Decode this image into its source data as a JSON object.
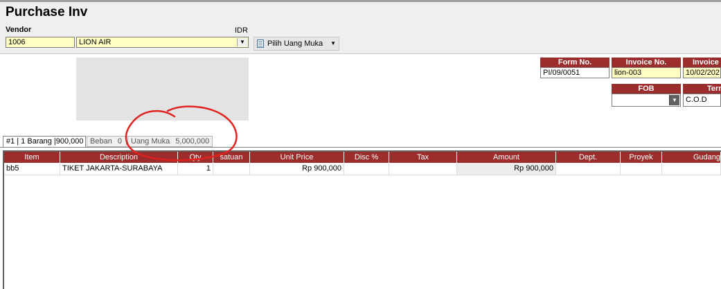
{
  "window": {
    "title": "Purchase Inv"
  },
  "vendor": {
    "label": "Vendor",
    "code": "1006",
    "name": "LION AIR",
    "currency": "IDR"
  },
  "toolbar": {
    "uang_muka_button": "Pilih Uang Muka"
  },
  "header_fields": {
    "form_no_label": "Form No.",
    "form_no_value": "PI/09/0051",
    "invoice_no_label": "Invoice No.",
    "invoice_no_value": "lion-003",
    "invoice_date_label": "Invoice",
    "invoice_date_value": "10/02/202",
    "fob_label": "FOB",
    "fob_value": "",
    "term_label": "Term",
    "term_value": "C.O.D"
  },
  "tabs": [
    {
      "label": "#1 | 1 Barang |900,000",
      "count": ""
    },
    {
      "label": "Beban",
      "count": "0"
    },
    {
      "label": "Uang Muka",
      "count": "5,000,000"
    }
  ],
  "grid": {
    "columns": [
      "Item",
      "Description",
      "Qty",
      "satuan",
      "Unit Price",
      "Disc %",
      "Tax",
      "Amount",
      "Dept.",
      "Proyek",
      "Gudang"
    ],
    "rows": [
      {
        "item": "bb5",
        "description": "TIKET JAKARTA-SURABAYA",
        "qty": "1",
        "satuan": "",
        "unit_price": "Rp 900,000",
        "disc": "",
        "tax": "",
        "amount": "Rp 900,000",
        "dept": "",
        "proyek": "",
        "gudang": ""
      }
    ]
  },
  "colors": {
    "header_red": "#9b2d2d",
    "input_yellow": "#ffffc4",
    "annotation_red": "#e0221f"
  },
  "icons": {
    "dropdown": "chevron-down-icon",
    "document": "document-icon"
  }
}
